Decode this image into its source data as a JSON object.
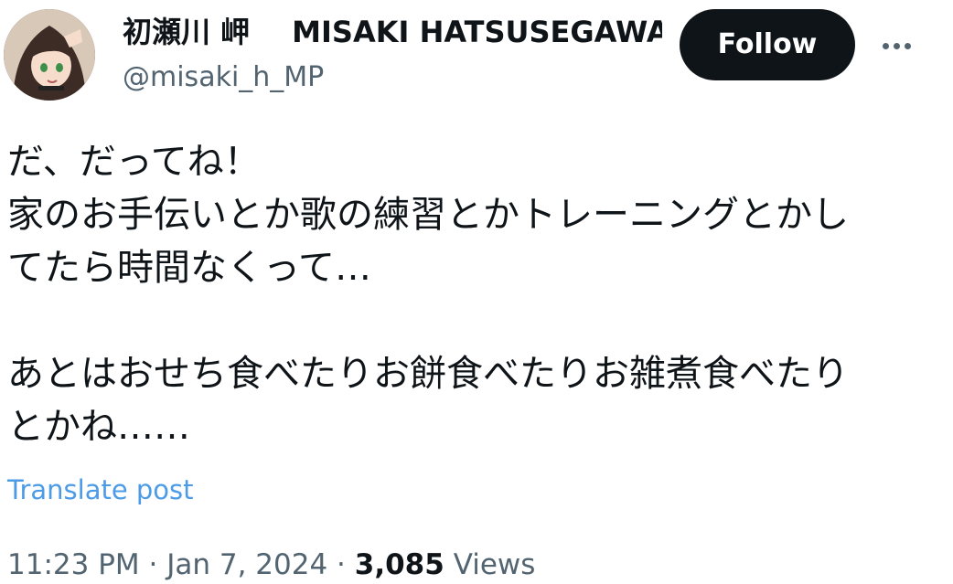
{
  "author": {
    "display_name": "初瀬川 岬",
    "display_name_suffix": "MISAKI HATSUSEGAWA",
    "name_emoji": "crescent-moon-icon",
    "handle": "@misaki_h_MP",
    "avatar": "avatar-image"
  },
  "actions": {
    "follow_label": "Follow",
    "more_icon": "more-options-icon"
  },
  "tweet": {
    "lines": [
      "だ、だってね！",
      "家のお手伝いとか歌の練習とかトレーニングとかし",
      "てたら時間なくって…",
      "",
      "あとはおせち食べたりお餅食べたりお雑煮食べたり",
      "とかね……"
    ]
  },
  "translate_label": "Translate post",
  "meta": {
    "time": "11:23 PM",
    "separator": "·",
    "date": "Jan 7, 2024",
    "view_count": "3,085",
    "views_label": "Views"
  },
  "colors": {
    "text": "#0f1419",
    "secondary": "#536471",
    "link": "#4b9be6",
    "button_bg": "#0f1419"
  }
}
